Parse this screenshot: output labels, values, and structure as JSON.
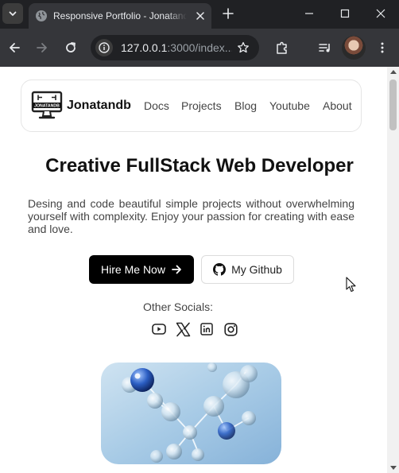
{
  "browser": {
    "tab_title": "Responsive Portfolio - Jonatandb",
    "url_host": "127.0.0.1",
    "url_path": ":3000/index..."
  },
  "nav": {
    "brand": "Jonatandb",
    "logo_text": "JONATANDB",
    "links": [
      "Docs",
      "Projects",
      "Blog",
      "Youtube",
      "About"
    ]
  },
  "hero": {
    "headline": "Creative FullStack Web Developer",
    "intro": "Desing and code beautiful simple projects without overwhelming yourself with complexity. Enjoy your passion for creating with ease and love.",
    "hire_label": "Hire Me Now",
    "github_label": "My Github"
  },
  "socials": {
    "label": "Other Socials:",
    "icons": [
      "youtube-icon",
      "x-icon",
      "linkedin-icon",
      "instagram-icon"
    ]
  },
  "colors": {
    "page_bg": "#ffffff",
    "primary_button": "#000000",
    "browser_chrome": "#35363a"
  }
}
